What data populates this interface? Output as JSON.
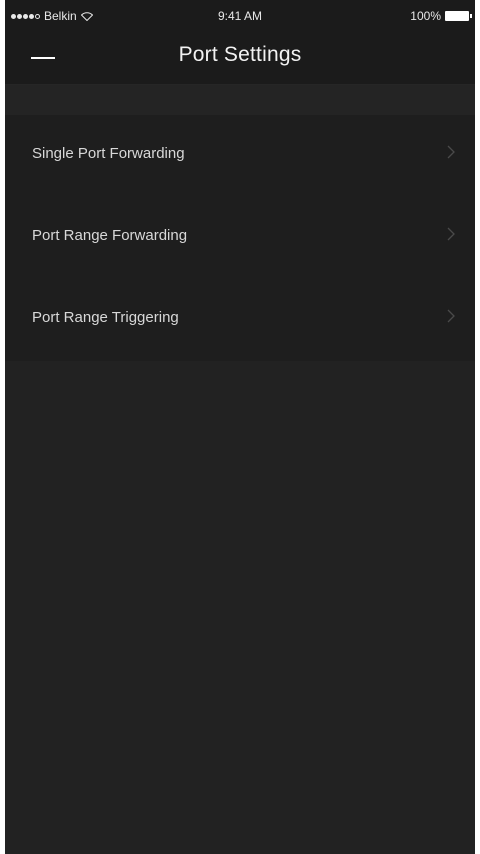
{
  "status_bar": {
    "carrier": "Belkin",
    "time": "9:41 AM",
    "battery": "100%",
    "icons": {
      "signal": "signal-strength-icon",
      "wifi": "wifi-icon",
      "battery": "battery-icon"
    }
  },
  "nav_bar": {
    "title": "Port Settings",
    "menu_icon": "hamburger-menu-icon"
  },
  "settings": {
    "items": [
      {
        "label": "Single Port Forwarding",
        "icon": "chevron-right-icon"
      },
      {
        "label": "Port Range Forwarding",
        "icon": "chevron-right-icon"
      },
      {
        "label": "Port Range Triggering",
        "icon": "chevron-right-icon"
      }
    ]
  },
  "colors": {
    "background": "#222222",
    "header": "#1b1b1b",
    "list": "#1e1e1e",
    "text": "#d8d8d8",
    "title": "#f2f2f2"
  }
}
